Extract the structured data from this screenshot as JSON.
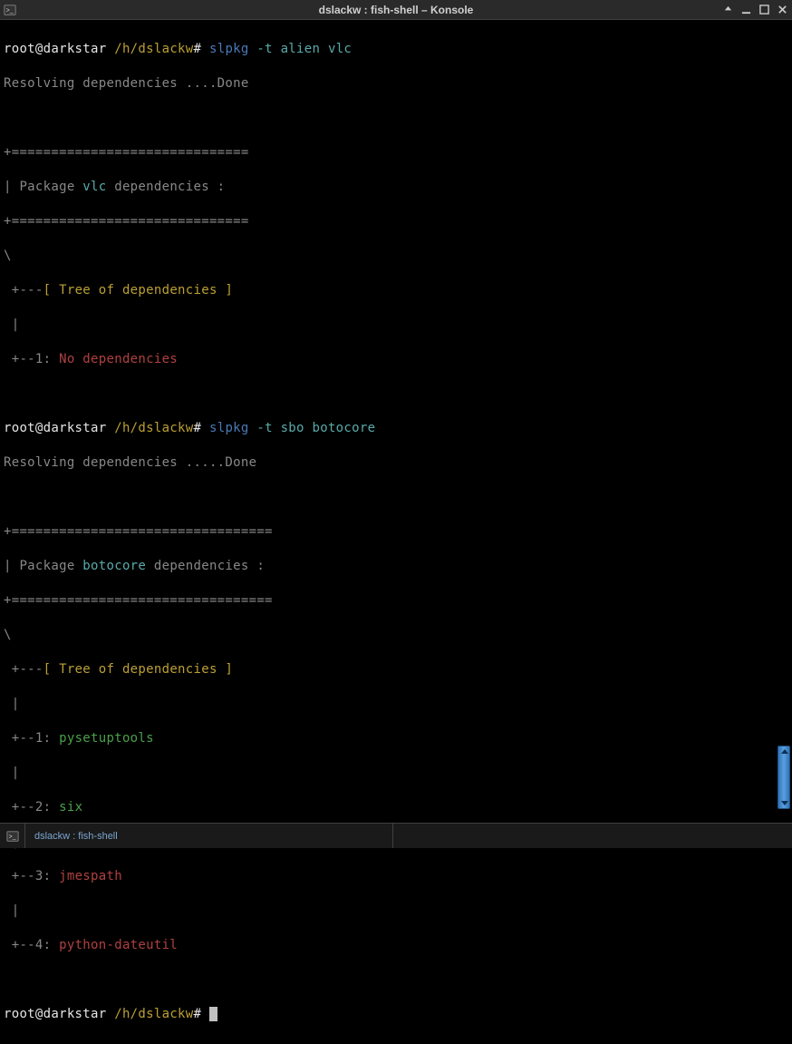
{
  "window": {
    "title": "dslackw : fish-shell – Konsole"
  },
  "prompt": {
    "user_host": "root@darkstar",
    "path": "/h/dslackw",
    "symbol": "#"
  },
  "session1": {
    "cmd": {
      "prog": "slpkg",
      "flag": "-t",
      "repo": "alien",
      "pkg": "vlc"
    },
    "resolving": "Resolving dependencies ....Done",
    "border": "+==============================",
    "pkg_label_pre": "| Package ",
    "pkg_name": "vlc",
    "pkg_label_post": " dependencies :",
    "slash": "\\",
    "tree_pre": " +---",
    "tree_label": "[ Tree of dependencies ]",
    "branch": " |",
    "item1_pre": " +--1:",
    "item1_val": "No dependencies"
  },
  "session2": {
    "cmd": {
      "prog": "slpkg",
      "flag": "-t",
      "repo": "sbo",
      "pkg": "botocore"
    },
    "resolving": "Resolving dependencies .....Done",
    "border": "+=================================",
    "pkg_label_pre": "| Package ",
    "pkg_name": "botocore",
    "pkg_label_post": " dependencies :",
    "slash": "\\",
    "tree_pre": " +---",
    "tree_label": "[ Tree of dependencies ]",
    "branch": " |",
    "item1_pre": " +--1:",
    "item1_val": "pysetuptools",
    "item2_pre": " +--2:",
    "item2_val": "six",
    "item3_pre": " +--3:",
    "item3_val": "jmespath",
    "item4_pre": " +--4:",
    "item4_val": "python-dateutil"
  },
  "tab": {
    "label": "dslackw : fish-shell"
  }
}
